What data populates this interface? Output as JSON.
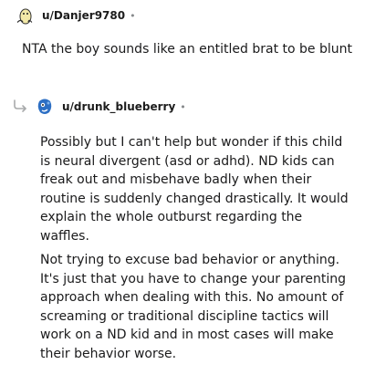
{
  "parent_comment": {
    "username": "u/Danjer9780",
    "separator": "•",
    "body": "NTA the boy sounds like an entitled brat to be blunt"
  },
  "reply_comment": {
    "username": "u/drunk_blueberry",
    "separator": "•",
    "paragraphs": [
      "Possibly but I can't help but wonder if this child is neural divergent (asd or adhd). ND kids can freak out and misbehave badly when their routine is suddenly changed drastically. It would explain the whole outburst regarding the waffles.",
      "Not trying to excuse bad behavior or anything. It's just that you have to change your parenting approach when dealing with this. No amount of screaming or traditional discipline tactics will work on a ND kid and in most cases will make their behavior worse."
    ]
  },
  "icons": {
    "parent_avatar": "avatar-icon",
    "reply_avatar": "avatar-icon",
    "reply_arrow": "reply-arrow-icon"
  },
  "colors": {
    "text": "#1a1a1b",
    "muted": "#878a8c",
    "arrow": "#a8aaab",
    "reply_avatar_blue": "#2d6fc4"
  }
}
